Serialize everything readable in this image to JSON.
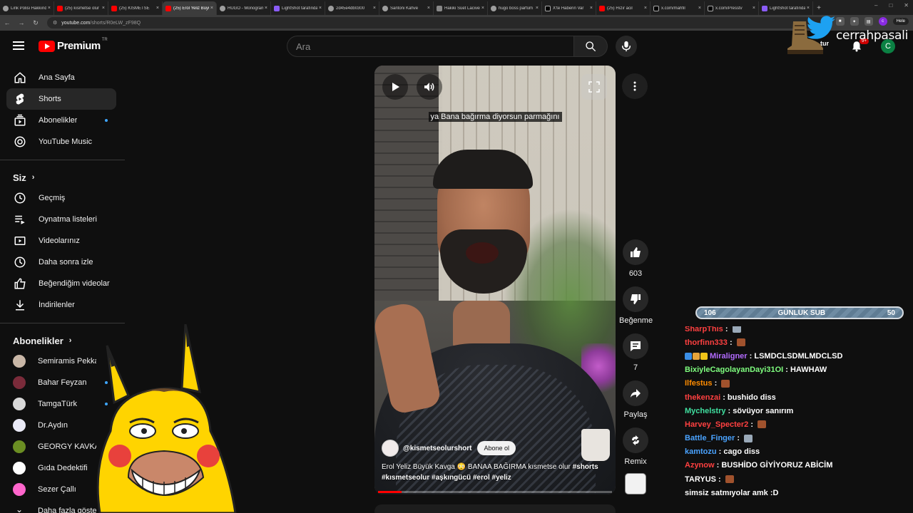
{
  "browser": {
    "tabs": [
      {
        "title": "Link Polisi Hakkında",
        "icon": "globe",
        "active": false
      },
      {
        "title": "(25) kısmetse olur",
        "icon": "youtube",
        "active": false
      },
      {
        "title": "(25) KISMETSE",
        "icon": "youtube",
        "active": false
      },
      {
        "title": "(25) Erol Yeliz Büyük",
        "icon": "youtube",
        "active": true
      },
      {
        "title": "HUGO - Monogram",
        "icon": "globe",
        "active": false
      },
      {
        "title": "LightShot tarafından",
        "icon": "lightshot",
        "active": false
      },
      {
        "title": "2d45e4db0300",
        "icon": "globe",
        "active": false
      },
      {
        "title": "Santoni Kahve",
        "icon": "globe",
        "active": false
      },
      {
        "title": "Hakiki Süet Lacivert",
        "icon": "doc",
        "active": false
      },
      {
        "title": "hugo boss parfüm",
        "icon": "globe",
        "active": false
      },
      {
        "title": "X'te Haberin Var",
        "icon": "x",
        "active": false
      },
      {
        "title": "(25) Hızır acil",
        "icon": "youtube",
        "active": false
      },
      {
        "title": "x.com/mahfil",
        "icon": "x",
        "active": false
      },
      {
        "title": "x.com/Presstv",
        "icon": "x",
        "active": false
      },
      {
        "title": "LightShot tarafından",
        "icon": "lightshot",
        "active": false
      }
    ],
    "url_host": "youtube.com",
    "url_path": "/shorts/R0eLW_zF98Q",
    "profile_label": "Hele"
  },
  "masthead": {
    "logo_text": "Premium",
    "logo_region": "TR",
    "search_placeholder": "Ara",
    "create_label": "tur",
    "notification_count": "9+",
    "avatar_letter": "C"
  },
  "sidebar": {
    "main": [
      {
        "label": "Ana Sayfa",
        "icon": "home-icon",
        "active": false,
        "dot": false
      },
      {
        "label": "Shorts",
        "icon": "shorts-icon",
        "active": true,
        "dot": false
      },
      {
        "label": "Abonelikler",
        "icon": "subscriptions-icon",
        "active": false,
        "dot": true
      },
      {
        "label": "YouTube Music",
        "icon": "music-icon",
        "active": false,
        "dot": false
      }
    ],
    "you_heading": "Siz",
    "you": [
      {
        "label": "Geçmiş",
        "icon": "history-icon"
      },
      {
        "label": "Oynatma listeleri",
        "icon": "playlist-icon"
      },
      {
        "label": "Videolarınız",
        "icon": "your-videos-icon"
      },
      {
        "label": "Daha sonra izle",
        "icon": "watch-later-icon"
      },
      {
        "label": "Beğendiğim videolar",
        "icon": "liked-icon"
      },
      {
        "label": "İndirilenler",
        "icon": "download-icon"
      }
    ],
    "subs_heading": "Abonelikler",
    "subscriptions": [
      {
        "label": "Semiramis Pekkan",
        "color": "#c9b7a7",
        "dot": false
      },
      {
        "label": "Bahar Feyzan",
        "color": "#7a2b3a",
        "dot": true
      },
      {
        "label": "TamgaTürk",
        "color": "#d9d9d9",
        "dot": true
      },
      {
        "label": "Dr.Aydın",
        "color": "#e9e9f5",
        "dot": false
      },
      {
        "label": "GEORGY KAVKAZ",
        "color": "#6b8e23",
        "dot": true
      },
      {
        "label": "Gıda Dedektifi",
        "color": "#ffffff",
        "dot": true
      },
      {
        "label": "Sezer Çallı",
        "color": "#ff66cc",
        "dot": true
      },
      {
        "label": "Daha fazla göster",
        "color": "#0f0f0f",
        "dot": false
      }
    ]
  },
  "short": {
    "subtitle": "ya Bana bağırma diyorsun parmağını",
    "channel_handle": "@kismetseolurshort",
    "subscribe_label": "Abone ol",
    "title_text": "Erol Yeliz Büyük Kavga 😳 BANAA BAĞIRMA kısmetse olur",
    "tags": [
      "#shorts",
      "#kısmetseolur",
      "#aşkıngücü",
      "#erol",
      "#yeliz"
    ],
    "progress": 0.1,
    "actions": {
      "like_count": "603",
      "dislike_label": "Beğenme",
      "comment_count": "7",
      "share_label": "Paylaş",
      "remix_label": "Remix"
    }
  },
  "overlay": {
    "twitter_handle": "cerrahpasali",
    "goal": {
      "current": "106",
      "label": "GÜNLUK SUB",
      "target": "50"
    },
    "chat": [
      {
        "user": "SharpThis",
        "color": "#ff4040",
        "text": "",
        "emote": "#9aa9b8",
        "badges": []
      },
      {
        "user": "thorfinn333",
        "color": "#ff4040",
        "text": "",
        "emote": "#a0522d",
        "badges": []
      },
      {
        "user": "Miraligner",
        "color": "#b36bff",
        "text": "LSMDCLSDMLMDCLSD",
        "emote": "",
        "badges": [
          "#3a8ee6",
          "#e6a33a",
          "#f0c419"
        ]
      },
      {
        "user": "BixiyleCagolayanDayi31OI",
        "color": "#7fff7f",
        "text": "HAWHAW",
        "emote": "",
        "badges": []
      },
      {
        "user": "Ilfestus",
        "color": "#ff8c00",
        "text": "",
        "emote": "#a0522d",
        "badges": []
      },
      {
        "user": "thekenzai",
        "color": "#ff4040",
        "text": "bushido diss",
        "emote": "",
        "badges": []
      },
      {
        "user": "Mychelstry",
        "color": "#40e0a0",
        "text": "sövüyor sanırım",
        "emote": "",
        "badges": []
      },
      {
        "user": "Harvey_Specter2",
        "color": "#ff4040",
        "text": "",
        "emote": "#a0522d",
        "badges": []
      },
      {
        "user": "Battle_Finger",
        "color": "#4aa3ff",
        "text": "",
        "emote": "#9aa9b8",
        "badges": []
      },
      {
        "user": "kamtozu",
        "color": "#4aa3ff",
        "text": "cago diss",
        "emote": "",
        "badges": []
      },
      {
        "user": "Azynow",
        "color": "#ff4040",
        "text": "BUSHİDO GİYİYORUZ ABİCİM",
        "emote": "",
        "badges": []
      },
      {
        "user": "TARYUS",
        "color": "#ffffff",
        "text": "",
        "emote": "#a0522d",
        "badges": []
      },
      {
        "user": "",
        "color": "#ffffff",
        "text": "simsiz satmıyolar amk :D",
        "emote": "",
        "badges": []
      }
    ]
  }
}
